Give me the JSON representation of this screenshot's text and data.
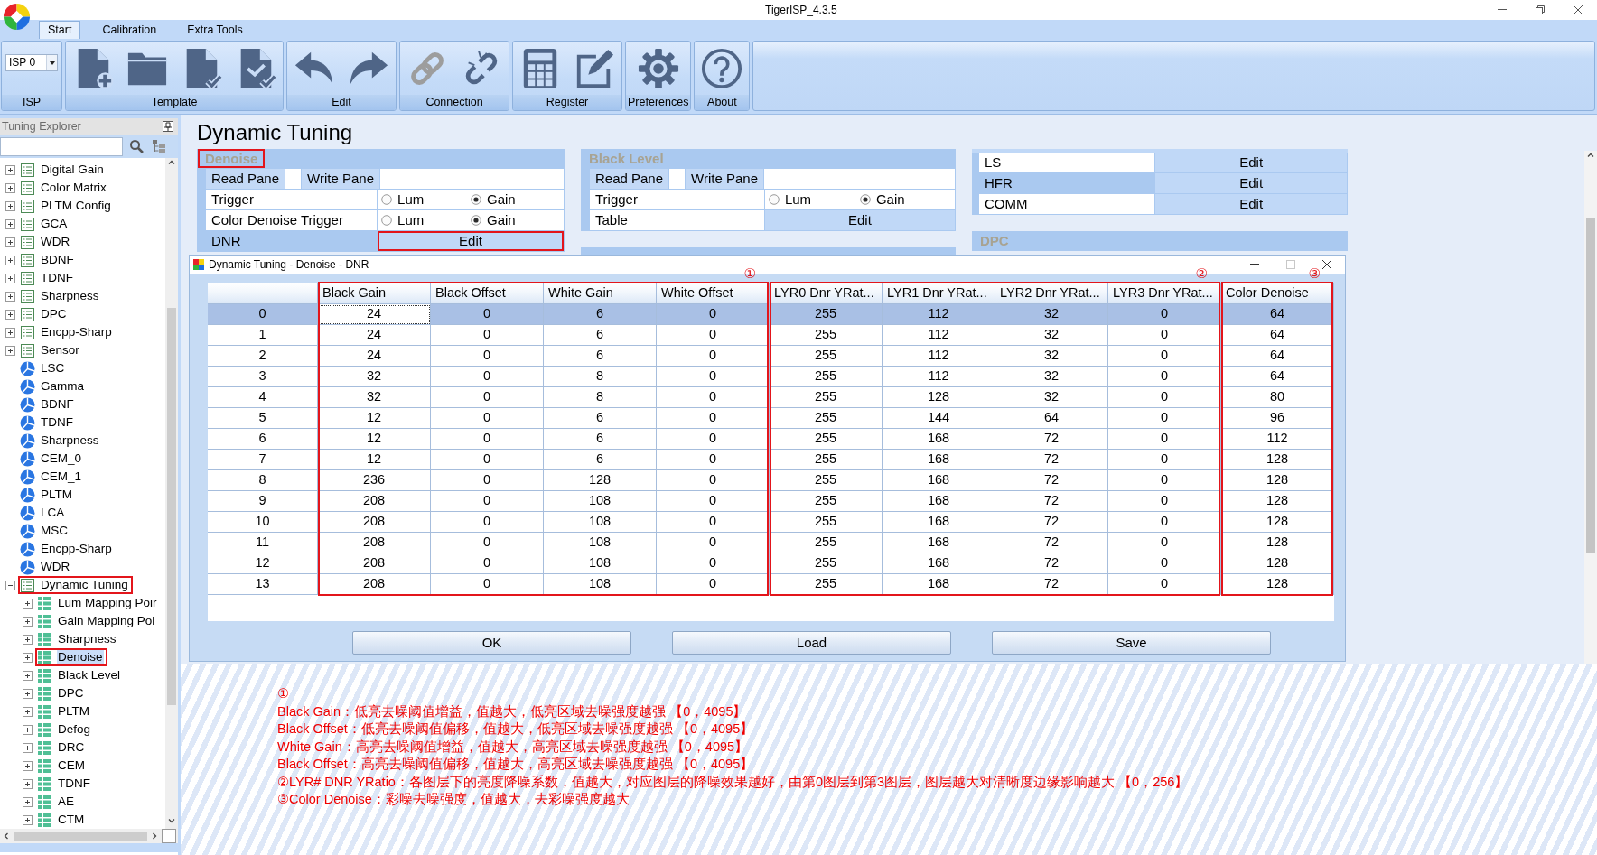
{
  "window": {
    "title": "TigerISP_4.3.5"
  },
  "ribbon": {
    "tabs": [
      {
        "label": "Start",
        "selected": true
      },
      {
        "label": "Calibration",
        "selected": false
      },
      {
        "label": "Extra Tools",
        "selected": false
      }
    ],
    "groups": [
      {
        "label": "ISP",
        "kind": "select",
        "value": "ISP 0"
      },
      {
        "label": "Template",
        "kind": "buttons",
        "buttons": [
          {
            "kind": "new",
            "disabled": false
          },
          {
            "kind": "open",
            "disabled": false
          },
          {
            "kind": "save",
            "disabled": false
          },
          {
            "kind": "save-as",
            "disabled": false
          }
        ]
      },
      {
        "label": "Edit",
        "kind": "buttons",
        "buttons": [
          {
            "kind": "undo",
            "disabled": false
          },
          {
            "kind": "redo",
            "disabled": false
          }
        ]
      },
      {
        "label": "Connection",
        "kind": "buttons",
        "buttons": [
          {
            "kind": "connect",
            "disabled": true
          },
          {
            "kind": "disconnect",
            "disabled": false
          }
        ]
      },
      {
        "label": "Register",
        "kind": "buttons",
        "buttons": [
          {
            "kind": "table",
            "disabled": false
          },
          {
            "kind": "edit",
            "disabled": false
          }
        ]
      },
      {
        "label": "Preferences",
        "kind": "buttons",
        "buttons": [
          {
            "kind": "settings",
            "disabled": false
          }
        ]
      },
      {
        "label": "About",
        "kind": "buttons",
        "buttons": [
          {
            "kind": "help",
            "disabled": false
          }
        ]
      }
    ]
  },
  "sidebar": {
    "title": "Tuning Explorer",
    "items": [
      {
        "label": "Digital Gain",
        "kind": "table",
        "expanded": false,
        "selected": false,
        "highlighted": false
      },
      {
        "label": "Color Matrix",
        "kind": "table",
        "expanded": false,
        "selected": false,
        "highlighted": false
      },
      {
        "label": "PLTM Config",
        "kind": "table",
        "expanded": false,
        "selected": false,
        "highlighted": false
      },
      {
        "label": "GCA",
        "kind": "table",
        "expanded": false,
        "selected": false,
        "highlighted": false
      },
      {
        "label": "WDR",
        "kind": "table",
        "expanded": false,
        "selected": false,
        "highlighted": false
      },
      {
        "label": "BDNF",
        "kind": "table",
        "expanded": false,
        "selected": false,
        "highlighted": false
      },
      {
        "label": "TDNF",
        "kind": "table",
        "expanded": false,
        "selected": false,
        "highlighted": false
      },
      {
        "label": "Sharpness",
        "kind": "table",
        "expanded": false,
        "selected": false,
        "highlighted": false
      },
      {
        "label": "DPC",
        "kind": "table",
        "expanded": false,
        "selected": false,
        "highlighted": false
      },
      {
        "label": "Encpp-Sharp",
        "kind": "table",
        "expanded": false,
        "selected": false,
        "highlighted": false
      },
      {
        "label": "Sensor",
        "kind": "table",
        "expanded": false,
        "selected": false,
        "highlighted": false
      },
      {
        "label": "LSC",
        "kind": "curve",
        "selected": false,
        "highlighted": false
      },
      {
        "label": "Gamma",
        "kind": "curve",
        "selected": false,
        "highlighted": false
      },
      {
        "label": "BDNF",
        "kind": "curve",
        "selected": false,
        "highlighted": false
      },
      {
        "label": "TDNF",
        "kind": "curve",
        "selected": false,
        "highlighted": false
      },
      {
        "label": "Sharpness",
        "kind": "curve",
        "selected": false,
        "highlighted": false
      },
      {
        "label": "CEM_0",
        "kind": "curve",
        "selected": false,
        "highlighted": false
      },
      {
        "label": "CEM_1",
        "kind": "curve",
        "selected": false,
        "highlighted": false
      },
      {
        "label": "PLTM",
        "kind": "curve",
        "selected": false,
        "highlighted": false
      },
      {
        "label": "LCA",
        "kind": "curve",
        "selected": false,
        "highlighted": false
      },
      {
        "label": "MSC",
        "kind": "curve",
        "selected": false,
        "highlighted": false
      },
      {
        "label": "Encpp-Sharp",
        "kind": "curve",
        "selected": false,
        "highlighted": false
      },
      {
        "label": "WDR",
        "kind": "curve",
        "selected": false,
        "highlighted": false
      },
      {
        "label": "Dynamic Tuning",
        "kind": "table",
        "expanded": true,
        "selected": false,
        "highlighted": true,
        "children": [
          {
            "label": "Lum Mapping Poir",
            "kind": "grid",
            "expanded": false,
            "selected": false,
            "highlighted": false
          },
          {
            "label": "Gain Mapping Poi",
            "kind": "grid",
            "expanded": false,
            "selected": false,
            "highlighted": false
          },
          {
            "label": "Sharpness",
            "kind": "grid",
            "expanded": false,
            "selected": false,
            "highlighted": false
          },
          {
            "label": "Denoise",
            "kind": "grid",
            "expanded": false,
            "selected": true,
            "highlighted": true
          },
          {
            "label": "Black Level",
            "kind": "grid",
            "expanded": false,
            "selected": false,
            "highlighted": false
          },
          {
            "label": "DPC",
            "kind": "grid",
            "expanded": false,
            "selected": false,
            "highlighted": false
          },
          {
            "label": "PLTM",
            "kind": "grid",
            "expanded": false,
            "selected": false,
            "highlighted": false
          },
          {
            "label": "Defog",
            "kind": "grid",
            "expanded": false,
            "selected": false,
            "highlighted": false
          },
          {
            "label": "DRC",
            "kind": "grid",
            "expanded": false,
            "selected": false,
            "highlighted": false
          },
          {
            "label": "CEM",
            "kind": "grid",
            "expanded": false,
            "selected": false,
            "highlighted": false
          },
          {
            "label": "TDNF",
            "kind": "grid",
            "expanded": false,
            "selected": false,
            "highlighted": false
          },
          {
            "label": "AE",
            "kind": "grid",
            "expanded": false,
            "selected": false,
            "highlighted": false
          },
          {
            "label": "CTM",
            "kind": "grid",
            "expanded": false,
            "selected": false,
            "highlighted": false
          }
        ]
      }
    ]
  },
  "main": {
    "title": "Dynamic Tuning",
    "panel_columns": [
      {
        "panels": [
          {
            "kind": "section",
            "title": "Denoise",
            "highlighted": true,
            "rows": [
              {
                "kind": "panes",
                "labels": [
                  "Read Pane",
                  "Write Pane"
                ]
              },
              {
                "kind": "radio",
                "label": "Trigger",
                "options": [
                  {
                    "label": "Lum",
                    "selected": false
                  },
                  {
                    "label": "Gain",
                    "selected": true
                  }
                ]
              },
              {
                "kind": "radio",
                "label": "Color Denoise Trigger",
                "options": [
                  {
                    "label": "Lum",
                    "selected": false
                  },
                  {
                    "label": "Gain",
                    "selected": true
                  }
                ]
              },
              {
                "kind": "button",
                "label": "DNR",
                "button": "Edit",
                "selected": true,
                "highlighted": true
              }
            ]
          }
        ]
      },
      {
        "panels": [
          {
            "kind": "section",
            "title": "Black Level",
            "highlighted": false,
            "rows": [
              {
                "kind": "panes",
                "labels": [
                  "Read Pane",
                  "Write Pane"
                ]
              },
              {
                "kind": "radio",
                "label": "Trigger",
                "options": [
                  {
                    "label": "Lum",
                    "selected": false
                  },
                  {
                    "label": "Gain",
                    "selected": true
                  }
                ]
              },
              {
                "kind": "button",
                "label": "Table",
                "button": "Edit",
                "selected": false,
                "highlighted": false
              }
            ]
          },
          {
            "kind": "stub"
          }
        ]
      },
      {
        "panels": [
          {
            "kind": "continued",
            "rows": [
              {
                "kind": "button",
                "label": "LS",
                "button": "Edit",
                "selected": false,
                "highlighted": false
              },
              {
                "kind": "button",
                "label": "HFR",
                "button": "Edit",
                "selected": true,
                "highlighted": false
              },
              {
                "kind": "button",
                "label": "COMM",
                "button": "Edit",
                "selected": false,
                "highlighted": false
              }
            ]
          },
          {
            "kind": "section",
            "title": "DPC",
            "highlighted": false
          }
        ]
      }
    ]
  },
  "dialog": {
    "title": "Dynamic Tuning - Denoise - DNR",
    "table": {
      "column_groups": [
        {
          "marker": "①",
          "columns": [
            "Black Gain",
            "Black Offset",
            "White Gain",
            "White Offset"
          ]
        },
        {
          "marker": "②",
          "columns": [
            "LYR0 Dnr YRat...",
            "LYR1 Dnr YRat...",
            "LYR2 Dnr YRat...",
            "LYR3 Dnr YRat..."
          ]
        },
        {
          "marker": "③",
          "columns": [
            "Color Denoise"
          ]
        }
      ],
      "rows": [
        {
          "label": "0",
          "selected": true,
          "values": [
            "24",
            "0",
            "6",
            "0",
            "255",
            "112",
            "32",
            "0",
            "64"
          ]
        },
        {
          "label": "1",
          "selected": false,
          "values": [
            "24",
            "0",
            "6",
            "0",
            "255",
            "112",
            "32",
            "0",
            "64"
          ]
        },
        {
          "label": "2",
          "selected": false,
          "values": [
            "24",
            "0",
            "6",
            "0",
            "255",
            "112",
            "32",
            "0",
            "64"
          ]
        },
        {
          "label": "3",
          "selected": false,
          "values": [
            "32",
            "0",
            "8",
            "0",
            "255",
            "112",
            "32",
            "0",
            "64"
          ]
        },
        {
          "label": "4",
          "selected": false,
          "values": [
            "32",
            "0",
            "8",
            "0",
            "255",
            "128",
            "32",
            "0",
            "80"
          ]
        },
        {
          "label": "5",
          "selected": false,
          "values": [
            "12",
            "0",
            "6",
            "0",
            "255",
            "144",
            "64",
            "0",
            "96"
          ]
        },
        {
          "label": "6",
          "selected": false,
          "values": [
            "12",
            "0",
            "6",
            "0",
            "255",
            "168",
            "72",
            "0",
            "112"
          ]
        },
        {
          "label": "7",
          "selected": false,
          "values": [
            "12",
            "0",
            "6",
            "0",
            "255",
            "168",
            "72",
            "0",
            "128"
          ]
        },
        {
          "label": "8",
          "selected": false,
          "values": [
            "236",
            "0",
            "128",
            "0",
            "255",
            "168",
            "72",
            "0",
            "128"
          ]
        },
        {
          "label": "9",
          "selected": false,
          "values": [
            "208",
            "0",
            "108",
            "0",
            "255",
            "168",
            "72",
            "0",
            "128"
          ]
        },
        {
          "label": "10",
          "selected": false,
          "values": [
            "208",
            "0",
            "108",
            "0",
            "255",
            "168",
            "72",
            "0",
            "128"
          ]
        },
        {
          "label": "11",
          "selected": false,
          "values": [
            "208",
            "0",
            "108",
            "0",
            "255",
            "168",
            "72",
            "0",
            "128"
          ]
        },
        {
          "label": "12",
          "selected": false,
          "values": [
            "208",
            "0",
            "108",
            "0",
            "255",
            "168",
            "72",
            "0",
            "128"
          ]
        },
        {
          "label": "13",
          "selected": false,
          "values": [
            "208",
            "0",
            "108",
            "0",
            "255",
            "168",
            "72",
            "0",
            "128"
          ]
        }
      ]
    },
    "buttons": [
      "OK",
      "Load",
      "Save"
    ]
  },
  "notes": [
    "①",
    "Black Gain：低亮去噪阈值增益，值越大，低亮区域去噪强度越强 【0，4095】",
    "Black Offset：低亮去噪阈值偏移，值越大，低亮区域去噪强度越强 【0，4095】",
    "White Gain：高亮去噪阈值增益，值越大，高亮区域去噪强度越强 【0，4095】",
    "Black Offset：高亮去噪阈值偏移，值越大，高亮区域去噪强度越强 【0，4095】",
    "②LYR# DNR YRatio：各图层下的亮度降噪系数，值越大，对应图层的降噪效果越好，由第0图层到第3图层，图层越大对清晰度边缘影响越大 【0，256】",
    "③Color Denoise：彩噪去噪强度，值越大，去彩噪强度越大"
  ]
}
